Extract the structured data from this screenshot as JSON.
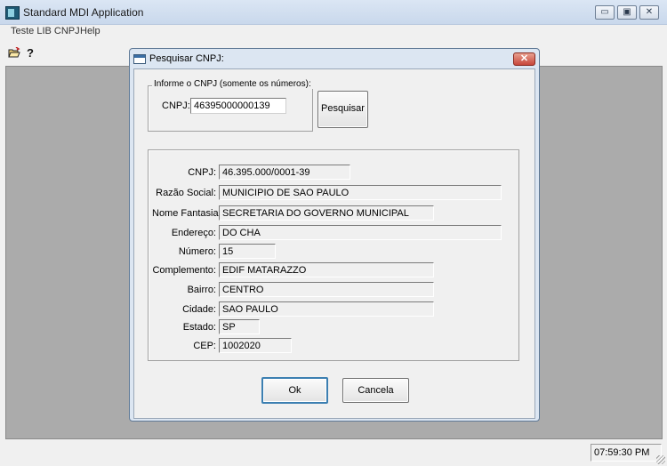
{
  "window": {
    "title": "Standard MDI Application",
    "controls": {
      "minimize": "▭",
      "maximize": "▣",
      "close": "✕"
    }
  },
  "menu": {
    "items": [
      "Teste LIB CNPJ",
      "Help"
    ]
  },
  "toolbar": {
    "open_icon": "open-folder-icon",
    "help_glyph": "?"
  },
  "status": {
    "time": "07:59:30 PM"
  },
  "dialog": {
    "title": "Pesquisar CNPJ:",
    "close_glyph": "✕",
    "search": {
      "group_label": "Informe o CNPJ (somente os números):",
      "cnpj_label": "CNPJ:",
      "cnpj_value": "46395000000139",
      "button": "Pesquisar"
    },
    "results": [
      {
        "label": "CNPJ:",
        "value": "46.395.000/0001-39"
      },
      {
        "label": "Razão Social:",
        "value": "MUNICIPIO DE SAO PAULO"
      },
      {
        "label": "Nome Fantasia:",
        "value": "SECRETARIA DO GOVERNO MUNICIPAL"
      },
      {
        "label": "Endereço:",
        "value": "DO CHA"
      },
      {
        "label": "Número:",
        "value": "15"
      },
      {
        "label": "Complemento:",
        "value": "EDIF MATARAZZO"
      },
      {
        "label": "Bairro:",
        "value": "CENTRO"
      },
      {
        "label": "Cidade:",
        "value": "SAO PAULO"
      },
      {
        "label": "Estado:",
        "value": "SP"
      },
      {
        "label": "CEP:",
        "value": "1002020"
      }
    ],
    "ok_button": "Ok",
    "cancel_button": "Cancela"
  }
}
